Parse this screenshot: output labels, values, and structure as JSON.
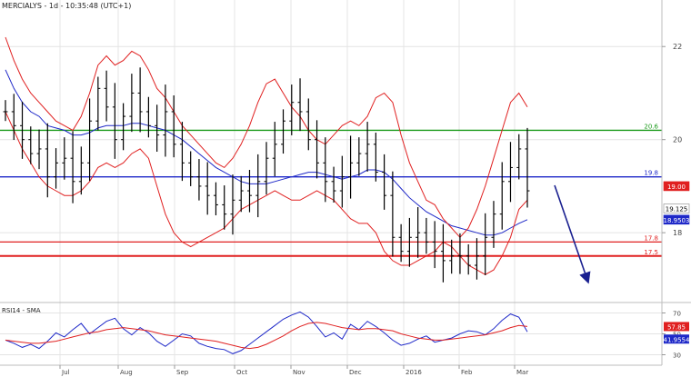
{
  "chart_data": [
    {
      "type": "line",
      "title": "MERCIALYS - 1d - 10:35:48 (UTC+1)",
      "subtype": "ohlc-bars-with-bollinger-bands",
      "ylim": [
        16.5,
        23.0
      ],
      "y_ticks": [
        18,
        20,
        22
      ],
      "x_tick_labels": [
        "Jul",
        "Aug",
        "Sep",
        "Oct",
        "Nov",
        "Dec",
        "2016",
        "Feb",
        "Mar"
      ],
      "horizontal_levels": [
        {
          "value": 20.2,
          "label": "20.6",
          "color": "#1a9a1a"
        },
        {
          "value": 19.2,
          "label": "19.8",
          "color": "#1e28c8"
        },
        {
          "value": 17.8,
          "label": "17.8",
          "color": "#e02020"
        },
        {
          "value": 17.5,
          "label": "17.5",
          "color": "#e02020"
        }
      ],
      "price_tags": [
        {
          "value": 19.0,
          "label": "19.00",
          "bg": "#e02020",
          "fg": "#ffffff"
        },
        {
          "value": 18.52,
          "label": "19.125",
          "bg": "#ffffff",
          "fg": "#000000"
        },
        {
          "value": 18.28,
          "label": "18.9503",
          "bg": "#1e28c8",
          "fg": "#ffffff"
        }
      ],
      "series": [
        {
          "role": "close",
          "color": "#000000",
          "values": [
            20.6,
            20.3,
            20.0,
            19.7,
            19.8,
            19.2,
            19.5,
            19.6,
            19.1,
            19.5,
            20.4,
            21.1,
            20.7,
            20.0,
            20.5,
            21.0,
            20.6,
            20.3,
            20.1,
            20.6,
            19.9,
            19.5,
            19.2,
            19.0,
            18.8,
            18.6,
            18.4,
            18.7,
            18.9,
            18.8,
            19.1,
            19.6,
            19.9,
            20.4,
            20.8,
            20.6,
            20.0,
            19.5,
            19.1,
            18.9,
            19.2,
            19.5,
            19.7,
            19.9,
            19.3,
            18.8,
            17.9,
            17.6,
            17.9,
            18.0,
            17.8,
            17.6,
            17.4,
            17.5,
            17.5,
            17.3,
            17.5,
            17.9,
            18.4,
            19.1,
            19.4,
            19.8,
            18.9
          ]
        },
        {
          "role": "moving-average",
          "color": "#1e28c8",
          "values": [
            21.5,
            21.1,
            20.8,
            20.6,
            20.5,
            20.3,
            20.25,
            20.2,
            20.1,
            20.1,
            20.15,
            20.25,
            20.3,
            20.3,
            20.3,
            20.35,
            20.35,
            20.3,
            20.25,
            20.2,
            20.1,
            20.0,
            19.85,
            19.7,
            19.55,
            19.4,
            19.3,
            19.2,
            19.1,
            19.05,
            19.05,
            19.05,
            19.1,
            19.15,
            19.2,
            19.25,
            19.3,
            19.3,
            19.25,
            19.2,
            19.15,
            19.2,
            19.25,
            19.35,
            19.35,
            19.3,
            19.15,
            18.95,
            18.75,
            18.6,
            18.45,
            18.35,
            18.25,
            18.15,
            18.1,
            18.05,
            18.0,
            17.95,
            17.95,
            18.0,
            18.1,
            18.2,
            18.28
          ]
        },
        {
          "role": "upper-band",
          "color": "#e02020",
          "values": [
            22.2,
            21.7,
            21.3,
            21.0,
            20.8,
            20.6,
            20.4,
            20.3,
            20.2,
            20.5,
            21.0,
            21.6,
            21.8,
            21.6,
            21.7,
            21.9,
            21.8,
            21.5,
            21.1,
            20.9,
            20.6,
            20.3,
            20.1,
            19.9,
            19.7,
            19.5,
            19.4,
            19.6,
            19.9,
            20.3,
            20.8,
            21.2,
            21.3,
            21.0,
            20.7,
            20.5,
            20.2,
            20.0,
            19.9,
            20.1,
            20.3,
            20.4,
            20.3,
            20.5,
            20.9,
            21.0,
            20.8,
            20.1,
            19.5,
            19.1,
            18.7,
            18.6,
            18.3,
            18.1,
            17.9,
            18.1,
            18.5,
            19.0,
            19.6,
            20.2,
            20.8,
            21.0,
            20.7
          ]
        },
        {
          "role": "lower-band",
          "color": "#e02020",
          "values": [
            20.6,
            20.2,
            19.8,
            19.5,
            19.2,
            19.0,
            18.9,
            18.8,
            18.8,
            18.9,
            19.1,
            19.4,
            19.5,
            19.4,
            19.5,
            19.7,
            19.8,
            19.6,
            19.0,
            18.4,
            18.0,
            17.8,
            17.7,
            17.8,
            17.9,
            18.0,
            18.1,
            18.3,
            18.5,
            18.6,
            18.7,
            18.8,
            18.9,
            18.8,
            18.7,
            18.7,
            18.8,
            18.9,
            18.8,
            18.7,
            18.5,
            18.3,
            18.2,
            18.2,
            18.0,
            17.6,
            17.4,
            17.3,
            17.3,
            17.4,
            17.5,
            17.6,
            17.8,
            17.7,
            17.5,
            17.3,
            17.2,
            17.1,
            17.2,
            17.5,
            17.9,
            18.5,
            18.7
          ]
        }
      ]
    },
    {
      "type": "line",
      "title": "RSI14 - SMA",
      "ylim": [
        20,
        80
      ],
      "y_ticks": [
        30,
        50,
        70
      ],
      "price_tags": [
        {
          "value": 57,
          "label": "57.85",
          "bg": "#e02020",
          "fg": "#ffffff"
        },
        {
          "value": 45,
          "label": "41.9554",
          "bg": "#1e28c8",
          "fg": "#ffffff"
        }
      ],
      "series": [
        {
          "role": "rsi",
          "color": "#1e28c8",
          "values": [
            44,
            41,
            37,
            40,
            36,
            43,
            51,
            47,
            54,
            60,
            50,
            56,
            62,
            65,
            55,
            49,
            56,
            51,
            43,
            38,
            44,
            50,
            48,
            41,
            38,
            36,
            35,
            31,
            34,
            40,
            46,
            52,
            58,
            64,
            68,
            71,
            66,
            57,
            47,
            51,
            45,
            59,
            54,
            62,
            57,
            51,
            44,
            39,
            41,
            45,
            48,
            42,
            44,
            46,
            50,
            53,
            52,
            49,
            55,
            63,
            69,
            66,
            52
          ]
        },
        {
          "role": "sma",
          "color": "#e02020",
          "values": [
            44,
            43,
            42,
            41,
            41,
            42,
            43,
            45,
            47,
            49,
            51,
            52,
            54,
            55,
            56,
            55,
            54,
            53,
            51,
            49,
            48,
            47,
            46,
            45,
            44,
            43,
            41,
            39,
            37,
            36,
            37,
            40,
            44,
            48,
            53,
            57,
            60,
            61,
            60,
            58,
            56,
            55,
            54,
            55,
            55,
            54,
            53,
            50,
            48,
            46,
            45,
            44,
            44,
            45,
            46,
            47,
            48,
            49,
            51,
            53,
            56,
            58,
            57
          ]
        }
      ]
    }
  ],
  "colors": {
    "ohlc": "#000000",
    "moving_average": "#1e28c8",
    "bands": "#e02020",
    "resistance": "#1a9a1a",
    "support": "#e02020",
    "arrow": "#1a2090",
    "grid": "#e4e4e4",
    "axis_text": "#444444"
  }
}
